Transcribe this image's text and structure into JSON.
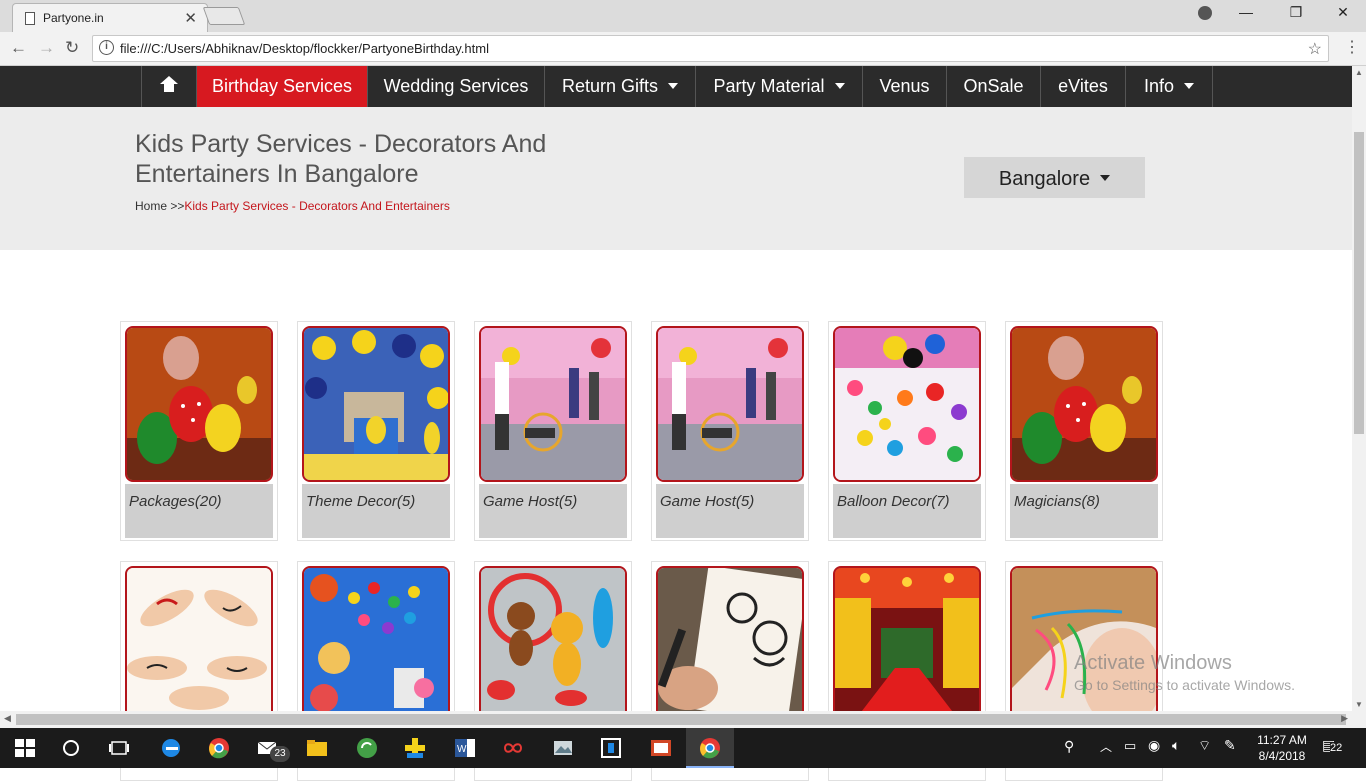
{
  "browser": {
    "tab_title": "Partyone.in",
    "url": "file:///C:/Users/Abhiknav/Desktop/flockker/PartyoneBirthday.html"
  },
  "nav": {
    "items": [
      {
        "label": "Birthday Services",
        "active": true
      },
      {
        "label": "Wedding Services"
      },
      {
        "label": "Return Gifts",
        "dropdown": true
      },
      {
        "label": "Party Material",
        "dropdown": true
      },
      {
        "label": "Venus"
      },
      {
        "label": "OnSale"
      },
      {
        "label": "eVites"
      },
      {
        "label": "Info",
        "dropdown": true
      }
    ]
  },
  "header": {
    "title": "Kids Party Services - Decorators And Entertainers In Bangalore",
    "breadcrumb_home": "Home",
    "breadcrumb_sep": ">>",
    "breadcrumb_current": "Kids Party Services - Decorators And Entertainers",
    "city": "Bangalore"
  },
  "cards_row1": [
    {
      "label": "Packages(20)",
      "image": "balloons"
    },
    {
      "label": "Theme Decor(5)",
      "image": "minions-decor"
    },
    {
      "label": "Game Host(5)",
      "image": "game-host"
    },
    {
      "label": "Game Host(5)",
      "image": "game-host"
    },
    {
      "label": "Balloon Decor(7)",
      "image": "balloon-ceiling"
    },
    {
      "label": "Magicians(8)",
      "image": "balloons"
    }
  ],
  "cards_row2": [
    {
      "image": "tattoo-hands"
    },
    {
      "image": "craft-beads"
    },
    {
      "image": "balloon-animals"
    },
    {
      "image": "caricature"
    },
    {
      "image": "lit-stage"
    },
    {
      "image": "hair-braids"
    }
  ],
  "watermark": {
    "line1": "Activate Windows",
    "line2": "Go to Settings to activate Windows."
  },
  "taskbar": {
    "time": "11:27 AM",
    "date": "8/4/2018",
    "mail_badge": "23",
    "notification_count": "22"
  },
  "colors": {
    "navbar": "#2b2b2b",
    "accent": "#d71920",
    "card_label_bg": "#cfcfcf"
  }
}
